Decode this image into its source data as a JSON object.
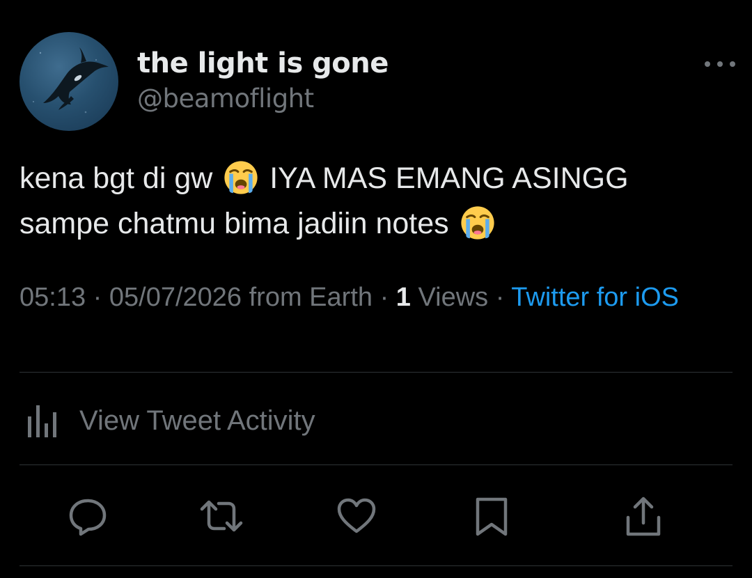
{
  "author": {
    "display_name": "the light is gone",
    "handle": "@beamoflight",
    "avatar_icon": "orca-avatar"
  },
  "more_icon": "more-horizontal-icon",
  "tweet": {
    "line1_a": "kena bgt di gw",
    "line1_b": "IYA MAS EMANG ASINGG",
    "line2_a": "sampe chatmu bima jadiin notes",
    "emoji": "loudly-crying-face"
  },
  "meta": {
    "time": "05:13",
    "date": "05/07/2026",
    "location": "from Earth",
    "views_count": "1",
    "views_label": "Views",
    "source": "Twitter for iOS",
    "separator": "·"
  },
  "activity": {
    "label": "View Tweet Activity",
    "icon": "analytics-icon"
  },
  "actions": {
    "reply_icon": "reply-icon",
    "retweet_icon": "retweet-icon",
    "like_icon": "like-icon",
    "bookmark_icon": "bookmark-icon",
    "share_icon": "share-icon"
  },
  "colors": {
    "background": "#000000",
    "text_primary": "#e7e9ea",
    "text_secondary": "#71767b",
    "link": "#1d9bf0",
    "divider": "#2f3336"
  }
}
